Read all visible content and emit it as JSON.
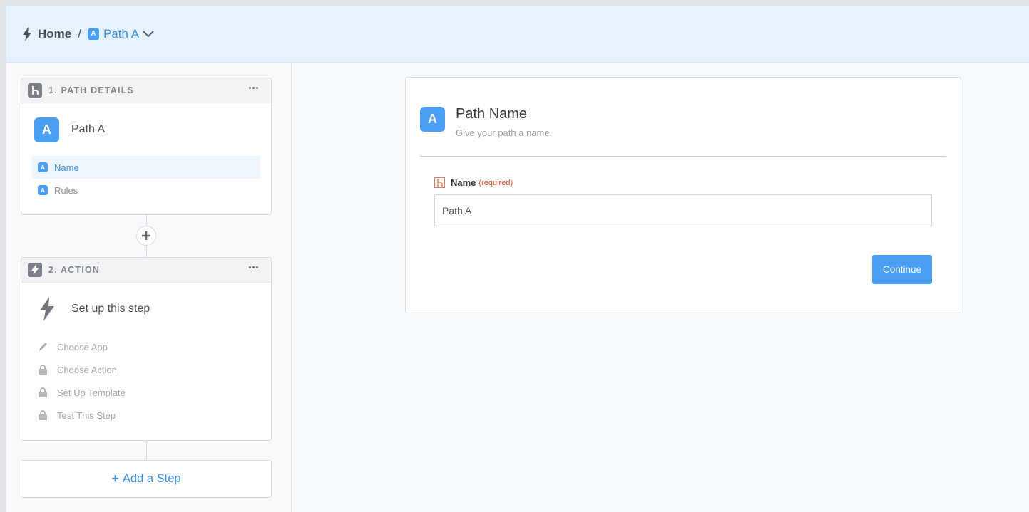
{
  "header": {
    "breadcrumb_home": "Home",
    "breadcrumb_separator": "/",
    "path_badge": "A",
    "path_label": "Path A"
  },
  "sidebar": {
    "step1": {
      "header_label": "1. PATH DETAILS",
      "badge": "A",
      "title": "Path A",
      "items": [
        {
          "badge": "A",
          "label": "Name",
          "active": true
        },
        {
          "badge": "A",
          "label": "Rules",
          "active": false
        }
      ]
    },
    "step2": {
      "header_label": "2. ACTION",
      "title": "Set up this step",
      "items": [
        {
          "icon": "pencil-icon",
          "label": "Choose App"
        },
        {
          "icon": "lock-icon",
          "label": "Choose Action"
        },
        {
          "icon": "lock-icon",
          "label": "Set Up Template"
        },
        {
          "icon": "lock-icon",
          "label": "Test This Step"
        }
      ]
    },
    "add_step_label": "Add a Step",
    "add_step_plus": "+"
  },
  "main": {
    "badge": "A",
    "title": "Path Name",
    "subtitle": "Give your path a name.",
    "field_label": "Name",
    "field_required": "(required)",
    "field_value": "Path A",
    "continue_label": "Continue"
  },
  "colors": {
    "accent": "#4a9ff5",
    "link": "#3d8fe0",
    "header_bg": "#e6f2fd",
    "required": "#d9502b"
  }
}
